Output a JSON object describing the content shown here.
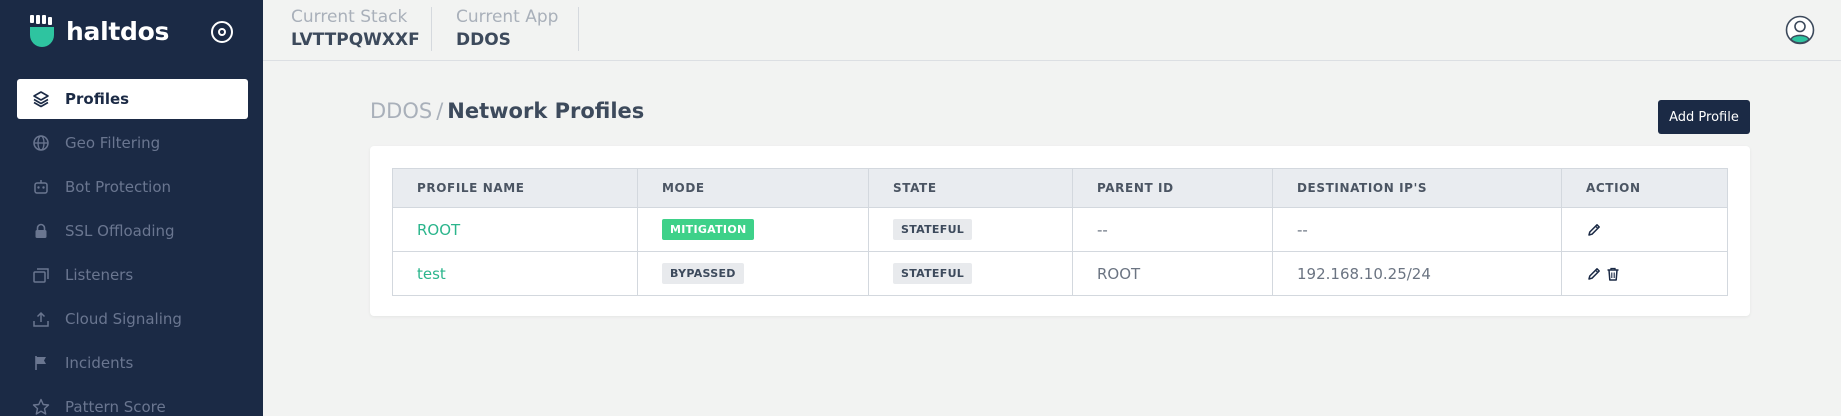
{
  "app": {
    "brand_name": "haltdos",
    "brand_color": "#2ec4a0",
    "sidebar_bg": "#1b2a45"
  },
  "sidebar": {
    "items": [
      {
        "label": "Profiles",
        "icon": "layers-icon",
        "active": true
      },
      {
        "label": "Geo Filtering",
        "icon": "globe-icon",
        "active": false
      },
      {
        "label": "Bot Protection",
        "icon": "robot-icon",
        "active": false
      },
      {
        "label": "SSL Offloading",
        "icon": "lock-icon",
        "active": false
      },
      {
        "label": "Listeners",
        "icon": "windows-icon",
        "active": false
      },
      {
        "label": "Cloud Signaling",
        "icon": "upload-icon",
        "active": false
      },
      {
        "label": "Incidents",
        "icon": "flag-icon",
        "active": false
      },
      {
        "label": "Pattern Score",
        "icon": "star-icon",
        "active": false
      }
    ]
  },
  "header": {
    "stack_label": "Current Stack",
    "stack_value": "LVTTPQWXXF",
    "app_label": "Current App",
    "app_value": "DDOS"
  },
  "page": {
    "breadcrumb_parent": "DDOS",
    "breadcrumb_sep": "/",
    "title": "Network Profiles",
    "add_button": "Add Profile"
  },
  "table": {
    "columns": [
      "PROFILE NAME",
      "MODE",
      "STATE",
      "PARENT ID",
      "DESTINATION IP'S",
      "ACTION"
    ],
    "rows": [
      {
        "name": "ROOT",
        "mode": "MITIGATION",
        "state": "STATEFUL",
        "parent": "--",
        "dest": "--",
        "actions": [
          "edit-icon"
        ]
      },
      {
        "name": "test",
        "mode": "BYPASSED",
        "state": "STATEFUL",
        "parent": "ROOT",
        "dest": "192.168.10.25/24",
        "actions": [
          "edit-icon",
          "trash-icon"
        ]
      }
    ]
  },
  "colors": {
    "accent_green": "#2bb58c",
    "mitigation_badge": "#3ed189",
    "primary_button": "#1b2a45"
  }
}
